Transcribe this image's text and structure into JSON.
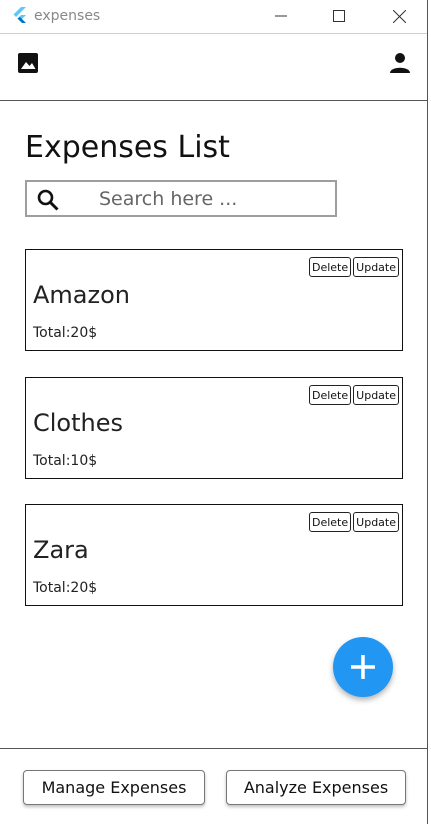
{
  "window": {
    "title": "expenses",
    "controls": [
      "minimize-icon",
      "maximize-icon",
      "close-icon"
    ]
  },
  "appbar": {
    "left_icon": "image-icon",
    "right_icon": "account-icon"
  },
  "page": {
    "title": "Expenses List"
  },
  "search": {
    "placeholder": "Search here ...",
    "value": ""
  },
  "expenses": [
    {
      "name": "Amazon",
      "total": "Total:20$",
      "delete_label": "Delete",
      "update_label": "Update"
    },
    {
      "name": "Clothes",
      "total": "Total:10$",
      "delete_label": "Delete",
      "update_label": "Update"
    },
    {
      "name": "Zara",
      "total": "Total:20$",
      "delete_label": "Delete",
      "update_label": "Update"
    }
  ],
  "fab": {
    "icon": "plus-icon"
  },
  "bottom": {
    "manage_label": "Manage Expenses",
    "analyze_label": "Analyze Expenses"
  },
  "colors": {
    "accent": "#2196f3",
    "logo_light": "#5ec8f8",
    "logo_dark": "#0175c2"
  }
}
